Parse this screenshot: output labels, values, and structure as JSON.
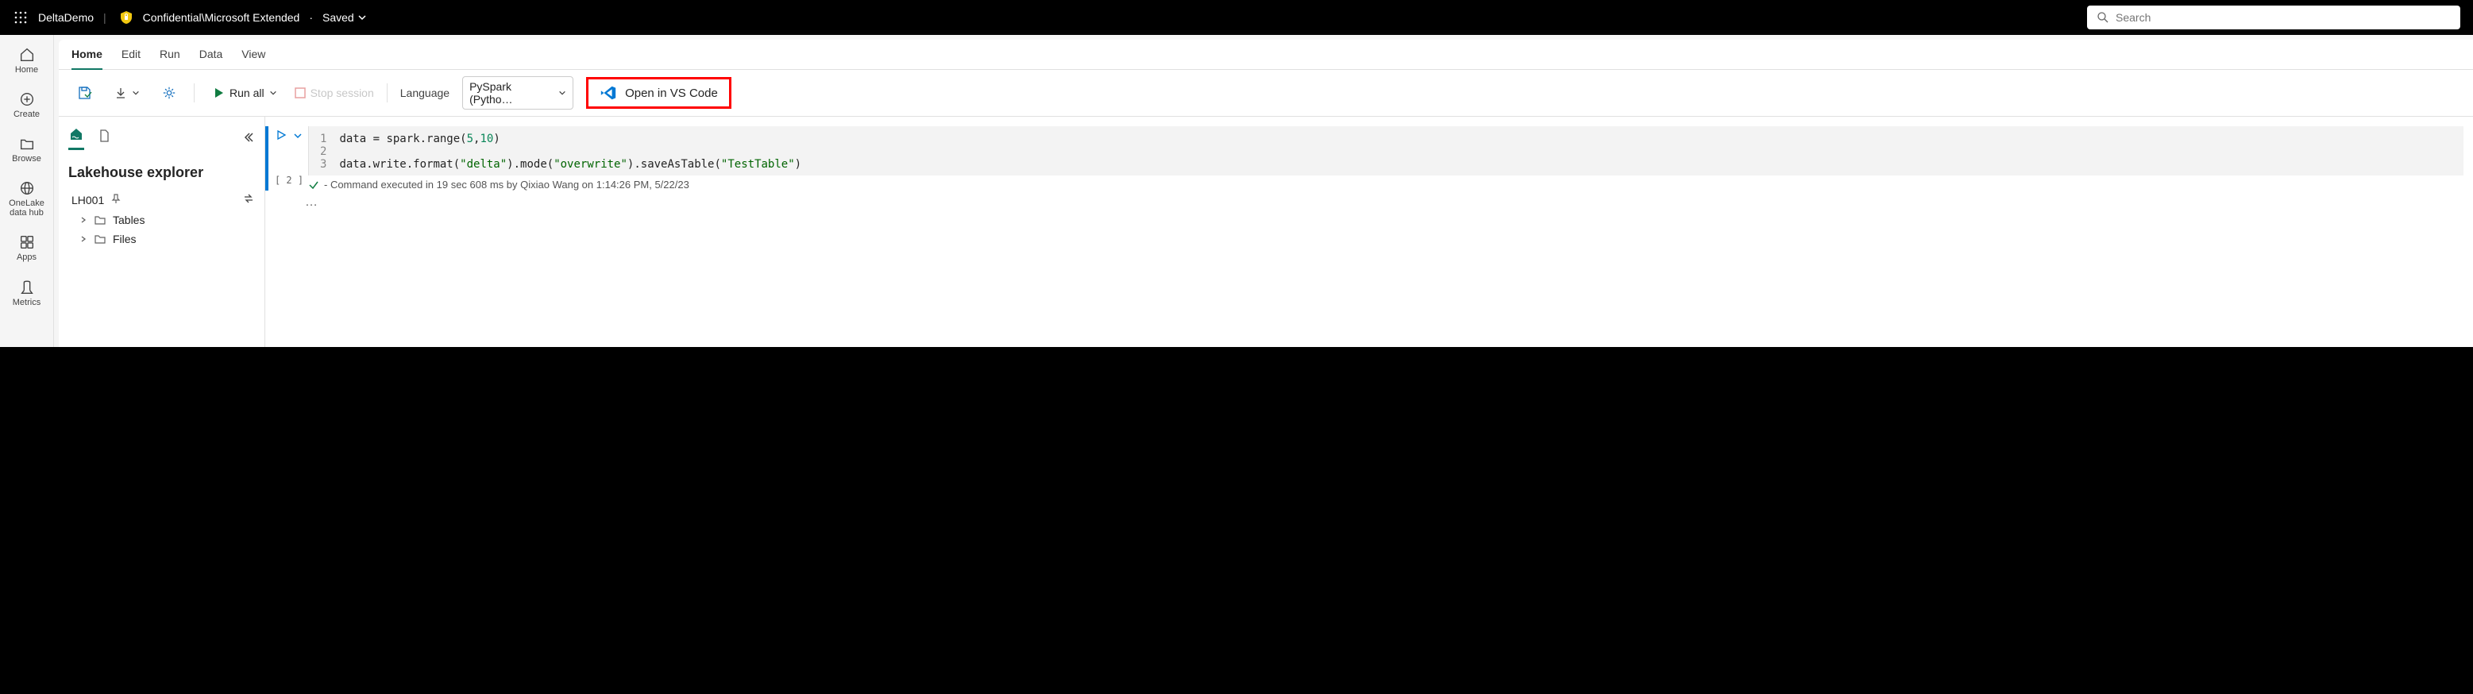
{
  "topbar": {
    "workspace_name": "DeltaDemo",
    "sensitivity_label": "Confidential\\Microsoft Extended",
    "save_status": "Saved",
    "search_placeholder": "Search"
  },
  "left_rail": {
    "items": [
      {
        "label": "Home"
      },
      {
        "label": "Create"
      },
      {
        "label": "Browse"
      },
      {
        "label": "OneLake data hub"
      },
      {
        "label": "Apps"
      },
      {
        "label": "Metrics"
      }
    ]
  },
  "tabs": {
    "items": [
      {
        "label": "Home"
      },
      {
        "label": "Edit"
      },
      {
        "label": "Run"
      },
      {
        "label": "Data"
      },
      {
        "label": "View"
      }
    ]
  },
  "toolbar": {
    "run_all": "Run all",
    "stop_session": "Stop session",
    "language_label": "Language",
    "language_value": "PySpark (Pytho…",
    "open_vscode": "Open in VS Code"
  },
  "explorer": {
    "title": "Lakehouse explorer",
    "lakehouse_name": "LH001",
    "tree": {
      "tables": "Tables",
      "files": "Files"
    }
  },
  "cell": {
    "exec_number": "[ 2 ]",
    "line_numbers": "1\n2\n3",
    "code_tokens": [
      {
        "t": "data = spark.range("
      },
      {
        "t": "5",
        "c": "n"
      },
      {
        "t": ","
      },
      {
        "t": "10",
        "c": "n"
      },
      {
        "t": ")\n\ndata.write.format("
      },
      {
        "t": "\"delta\"",
        "c": "k"
      },
      {
        "t": ").mode("
      },
      {
        "t": "\"overwrite\"",
        "c": "k"
      },
      {
        "t": ").saveAsTable("
      },
      {
        "t": "\"TestTable\"",
        "c": "k"
      },
      {
        "t": ")"
      }
    ],
    "status": "- Command executed in 19 sec 608 ms by Qixiao Wang on 1:14:26 PM, 5/22/23",
    "ellipsis": "…"
  }
}
